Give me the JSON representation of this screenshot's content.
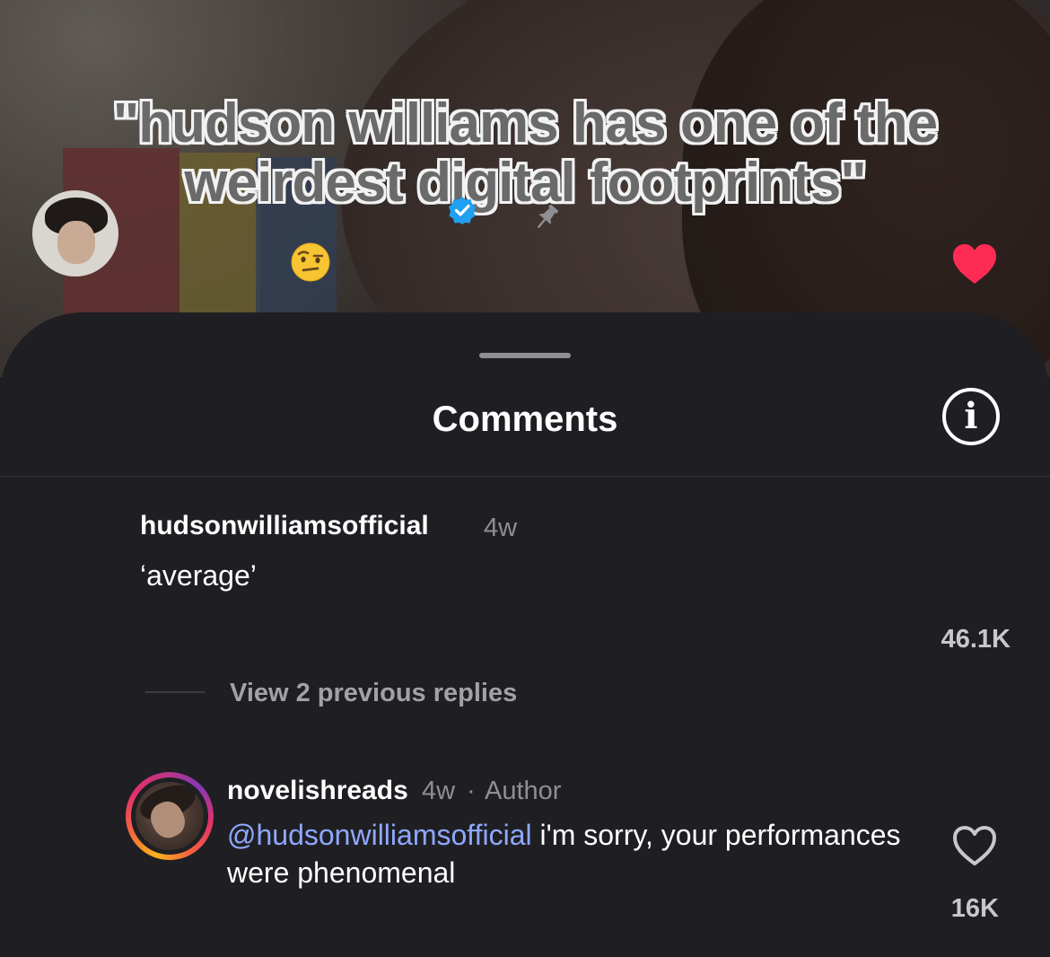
{
  "video": {
    "overlay_lines": [
      "\"hudson williams has one of the",
      "weirdest digital footprints\""
    ]
  },
  "sheet": {
    "title": "Comments",
    "info_icon": "info-icon",
    "info_glyph": "i"
  },
  "comments": [
    {
      "username": "hudsonwilliamsofficial",
      "verified": true,
      "time": "4w",
      "pinned": true,
      "text": "‘average’",
      "emoji": "raised-eyebrow-face",
      "liked": true,
      "likes": "46.1K"
    }
  ],
  "replies_toggle": "View 2 previous replies",
  "reply": {
    "username": "novelishreads",
    "time": "4w",
    "separator": "·",
    "badge": "Author",
    "mention": "@hudsonwilliamsofficial",
    "text": " i'm sorry, your performances were phenomenal",
    "liked": false,
    "likes": "16K"
  },
  "colors": {
    "background": "#1f1f23",
    "like_red": "#fe2c55",
    "mention_blue": "#8fa8ff",
    "verified_blue": "#20a0f0"
  }
}
